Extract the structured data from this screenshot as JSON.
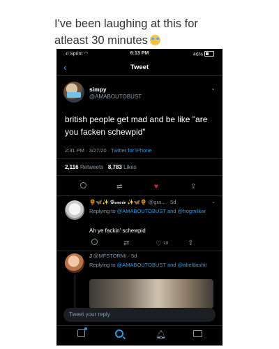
{
  "caption": "I've been laughing at this for atleast 30 minutes",
  "status": {
    "carrier": "Sprint",
    "time": "6:13 PM",
    "battery": "46%"
  },
  "nav": {
    "title": "Tweet",
    "back": "‹"
  },
  "tweet": {
    "name": "simpy",
    "handle": "@AMABOUTOBUST",
    "text": "british people get mad and be like \"are you facken schewpid\"",
    "time": "2:31 PM · 3/27/20 · ",
    "client": "Twitter for iPhone",
    "retweets": "2,116",
    "retweets_label": "Retweets",
    "likes": "8,783",
    "likes_label": "Likes"
  },
  "replies": [
    {
      "name": "🌻🦋✨ 𝓖𝓻𝓪𝓬𝓲𝓮 ✨🦋🌻",
      "meta": "@gra... · 5d",
      "replying": "Replying to ",
      "mentions": "@AMABOUTOBUST and @frogmilker",
      "text": "Ah ye fackin' schewpid",
      "likes": "19"
    },
    {
      "name": "J",
      "meta": "@MFSTORMI · 5d",
      "replying": "Replying to ",
      "mentions": "@AMABOUTOBUST and @abeldashit",
      "text": ""
    }
  ],
  "reply_placeholder": "Tweet your reply",
  "colors": {
    "accent": "#1da1f2",
    "like": "#e0245e",
    "muted": "#8899a6"
  }
}
